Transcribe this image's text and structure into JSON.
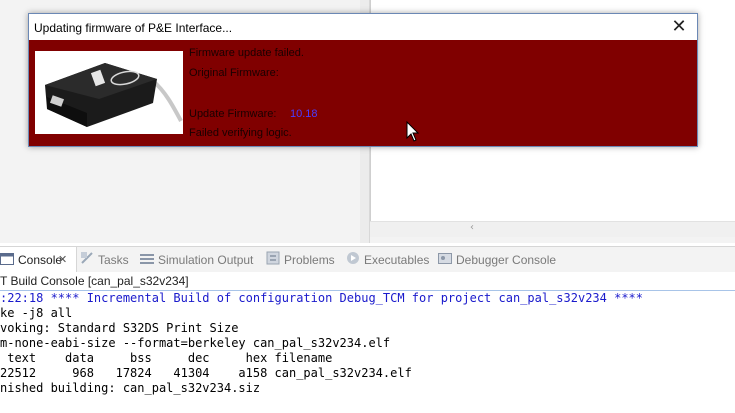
{
  "dialog": {
    "title": "Updating firmware of P&E Interface...",
    "close_glyph": "✕",
    "lines": {
      "status": "Firmware update failed.",
      "original": "Original Firmware:",
      "update_label": "Update Firmware:",
      "update_value": "10.18",
      "error": "Failed verifying logic."
    }
  },
  "tabs": [
    {
      "label": "Console",
      "icon": "console-icon"
    },
    {
      "label": "Tasks",
      "icon": "tasks-icon"
    },
    {
      "label": "Simulation Output",
      "icon": "list-icon"
    },
    {
      "label": "Problems",
      "icon": "problems-icon"
    },
    {
      "label": "Executables",
      "icon": "executables-icon"
    },
    {
      "label": "Debugger Console",
      "icon": "debugger-console-icon"
    }
  ],
  "console": {
    "header": "T Build Console [can_pal_s32v234]",
    "lines": [
      ":22:18 **** Incremental Build of configuration Debug_TCM for project can_pal_s32v234 ****",
      "ke -j8 all",
      "voking: Standard S32DS Print Size",
      "m-none-eabi-size --format=berkeley can_pal_s32v234.elf",
      " text    data     bss     dec     hex filename",
      "22512     968   17824   41304    a158 can_pal_s32v234.elf",
      "nished building: can_pal_s32v234.siz"
    ]
  },
  "colors": {
    "dialog_body": "#800000",
    "version_text": "#4a3cff",
    "console_blue": "#1a1acc"
  }
}
